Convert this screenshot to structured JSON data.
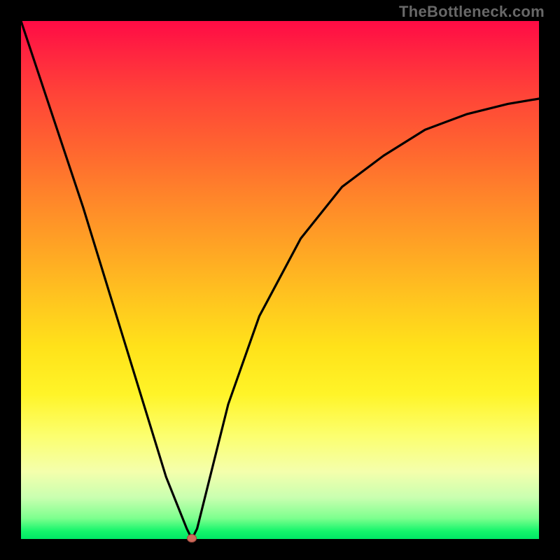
{
  "watermark": "TheBottleneck.com",
  "chart_data": {
    "type": "line",
    "title": "",
    "xlabel": "",
    "ylabel": "",
    "xlim": [
      0,
      100
    ],
    "ylim": [
      0,
      100
    ],
    "grid": false,
    "legend": false,
    "series": [
      {
        "name": "curve",
        "x": [
          0,
          4,
          8,
          12,
          16,
          20,
          24,
          28,
          32,
          33,
          34,
          36,
          40,
          46,
          54,
          62,
          70,
          78,
          86,
          94,
          100
        ],
        "y": [
          100,
          88,
          76,
          64,
          51,
          38,
          25,
          12,
          2,
          0,
          2,
          10,
          26,
          43,
          58,
          68,
          74,
          79,
          82,
          84,
          85
        ]
      }
    ],
    "marker": {
      "x": 33,
      "y": 0,
      "color": "#cf6a5b"
    },
    "background_gradient": {
      "direction": "vertical",
      "stops": [
        {
          "pos": 0,
          "color": "#ff0b45"
        },
        {
          "pos": 50,
          "color": "#ffb522"
        },
        {
          "pos": 75,
          "color": "#fff84a"
        },
        {
          "pos": 100,
          "color": "#00e865"
        }
      ]
    }
  }
}
